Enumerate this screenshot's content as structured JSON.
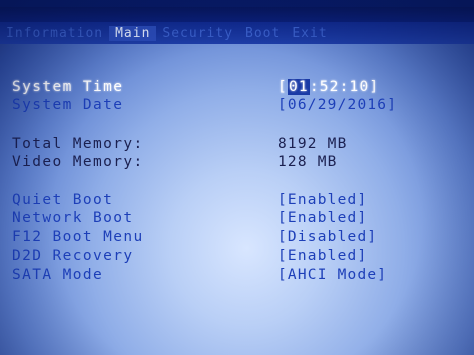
{
  "menu": {
    "tabs": [
      {
        "label": "Information"
      },
      {
        "label": "Main"
      },
      {
        "label": "Security"
      },
      {
        "label": "Boot"
      },
      {
        "label": "Exit"
      }
    ]
  },
  "system": {
    "time_label": "System Time",
    "time_open": "[",
    "time_hour": "01",
    "time_rest": ":52:10]",
    "date_label": "System Date",
    "date_value": "[06/29/2016]"
  },
  "memory": {
    "total_label": "Total Memory:",
    "total_value": "8192 MB",
    "video_label": "Video Memory:",
    "video_value": "128 MB"
  },
  "options": [
    {
      "label": "Quiet Boot",
      "value": "[Enabled]"
    },
    {
      "label": "Network Boot",
      "value": "[Enabled]"
    },
    {
      "label": "F12 Boot Menu",
      "value": "[Disabled]"
    },
    {
      "label": "D2D Recovery",
      "value": "[Enabled]"
    },
    {
      "label": "SATA Mode",
      "value": "[AHCI Mode]"
    }
  ]
}
